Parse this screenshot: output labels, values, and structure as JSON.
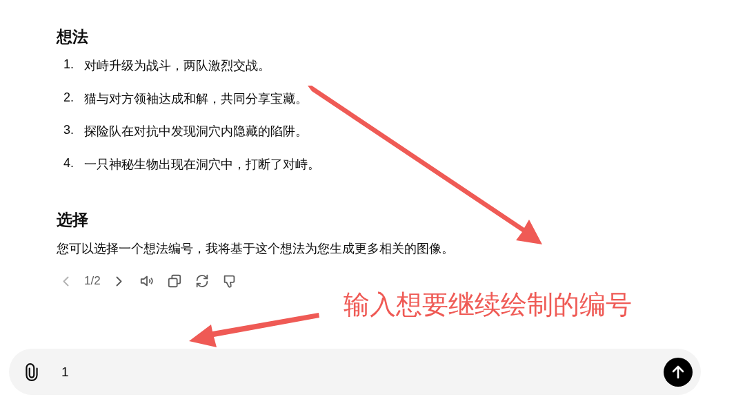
{
  "sections": [
    {
      "heading": "想法",
      "items": [
        {
          "number": "1.",
          "text": "对峙升级为战斗，两队激烈交战。"
        },
        {
          "number": "2.",
          "text": "猫与对方领袖达成和解，共同分享宝藏。"
        },
        {
          "number": "3.",
          "text": "探险队在对抗中发现洞穴内隐藏的陷阱。"
        },
        {
          "number": "4.",
          "text": "一只神秘生物出现在洞穴中，打断了对峙。"
        }
      ]
    },
    {
      "heading": "选择",
      "paragraph": "您可以选择一个想法编号，我将基于这个想法为您生成更多相关的图像。"
    }
  ],
  "pager": {
    "text": "1/2",
    "prev_disabled": true
  },
  "composer": {
    "value": "1"
  },
  "annotation": {
    "text": "输入想要继续绘制的编号"
  }
}
